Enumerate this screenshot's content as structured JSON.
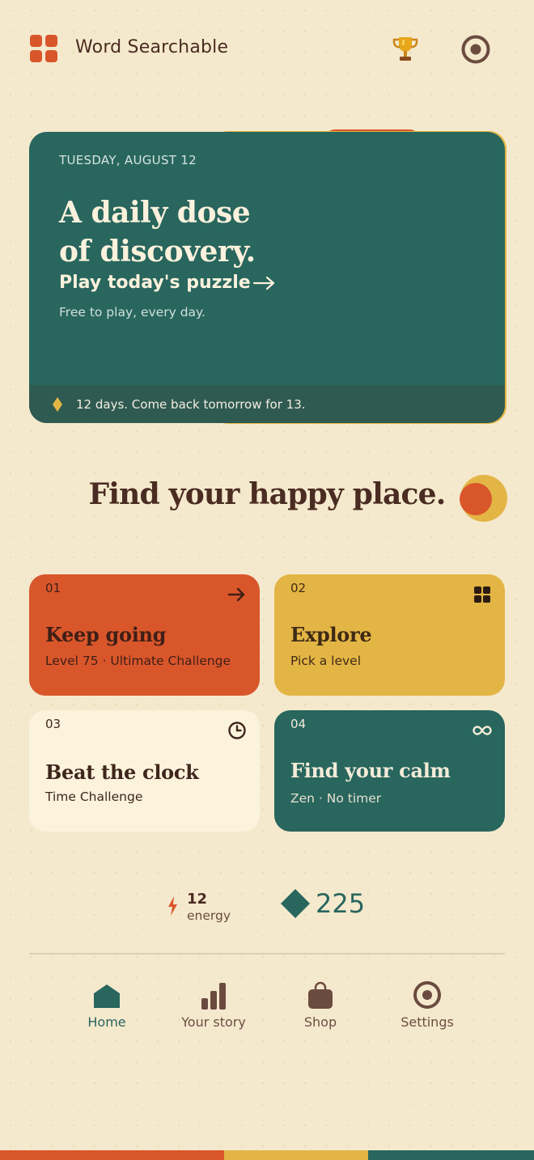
{
  "header": {
    "app_title": "Word Searchable",
    "menu_icon": "grid-icon",
    "achievements_icon": "trophy-icon",
    "profile_icon": "target-icon"
  },
  "hero": {
    "date": "TUESDAY, AUGUST 12",
    "title_line1": "A daily dose",
    "title_line2": "of discovery.",
    "cta_label": "Play today's puzzle",
    "subtitle": "Free to play, every day.",
    "streak_text": "12 days. Come back tomorrow for 13."
  },
  "section": {
    "title": "Find your happy place."
  },
  "modes": [
    {
      "number": "01",
      "title": "Keep going",
      "subtitle": "Level 75 · Ultimate Challenge",
      "icon": "arrow-right-icon"
    },
    {
      "number": "02",
      "title": "Explore",
      "subtitle": "Pick a level",
      "icon": "grid-icon"
    },
    {
      "number": "03",
      "title": "Beat the clock",
      "subtitle": "Time Challenge",
      "icon": "clock-icon"
    },
    {
      "number": "04",
      "title": "Find your calm",
      "subtitle": "Zen · No timer",
      "icon": "infinity-icon"
    }
  ],
  "stats": {
    "energy_value": "12",
    "energy_label": "energy",
    "gems_value": "225"
  },
  "nav": [
    {
      "label": "Home",
      "icon": "home-icon",
      "active": true
    },
    {
      "label": "Your story",
      "icon": "bar-chart-icon",
      "active": false
    },
    {
      "label": "Shop",
      "icon": "bag-icon",
      "active": false
    },
    {
      "label": "Settings",
      "icon": "target-icon",
      "active": false
    }
  ],
  "colors": {
    "background": "#f5e9cd",
    "orange": "#d9562b",
    "mustard": "#e3b545",
    "teal": "#28665e",
    "cream": "#fcf3dc",
    "brown": "#4a2c22"
  }
}
